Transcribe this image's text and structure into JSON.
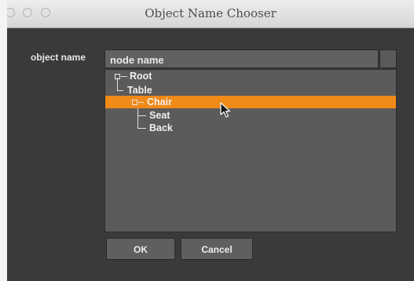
{
  "window": {
    "title": "Object Name Chooser"
  },
  "form": {
    "object_name_label": "object name",
    "input_value": "node name"
  },
  "tree": {
    "items": [
      {
        "label": "Root",
        "expanded": true,
        "selected": false
      },
      {
        "label": "Table",
        "selected": false
      },
      {
        "label": "Chair",
        "expanded": true,
        "selected": true
      },
      {
        "label": "Seat",
        "selected": false
      },
      {
        "label": "Back",
        "selected": false
      }
    ],
    "selection_color": "#f08a18"
  },
  "buttons": {
    "ok": "OK",
    "cancel": "Cancel"
  },
  "icons": {
    "expander": "minus-square-icon",
    "pointer": "arrow-cursor-icon"
  }
}
